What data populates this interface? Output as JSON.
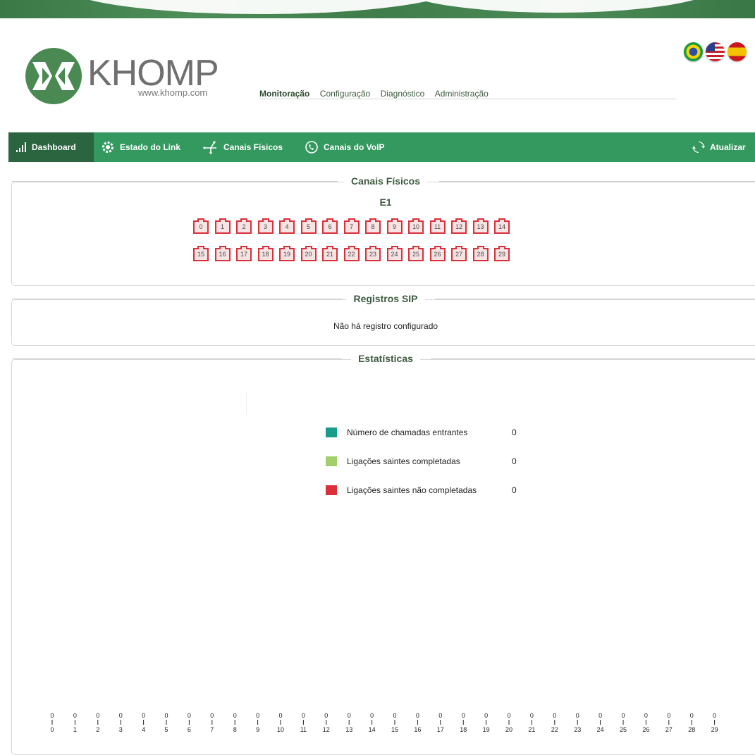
{
  "brand": {
    "name": "KHOMP",
    "url": "www.khomp.com"
  },
  "flags": [
    {
      "name": "brazil-flag-icon",
      "cls": "br"
    },
    {
      "name": "usa-flag-icon",
      "cls": "us"
    },
    {
      "name": "spain-flag-icon",
      "cls": "es"
    }
  ],
  "top_menu": [
    "Monitoração",
    "Configuração",
    "Diagnóstico",
    "Administração"
  ],
  "nav": {
    "dashboard": "Dashboard",
    "link_state": "Estado do Link",
    "physical_channels": "Canais Físicos",
    "voip_channels": "Canais do VoIP",
    "refresh": "Atualizar"
  },
  "colors": {
    "nav_bg": "#33995f",
    "nav_active": "#2b6540",
    "channel_border": "#d9303a"
  },
  "physical": {
    "title": "Canais Físicos",
    "link_label": "E1",
    "row1": [
      "0",
      "1",
      "2",
      "3",
      "4",
      "5",
      "6",
      "7",
      "8",
      "9",
      "10",
      "11",
      "12",
      "13",
      "14"
    ],
    "row2": [
      "15",
      "16",
      "17",
      "18",
      "19",
      "20",
      "21",
      "22",
      "23",
      "24",
      "25",
      "26",
      "27",
      "28",
      "29"
    ]
  },
  "sip": {
    "title": "Registros SIP",
    "message": "Não há registro configurado"
  },
  "stats": {
    "title": "Estatísticas",
    "legend": [
      {
        "name": "Número de chamadas entrantes",
        "value": "0",
        "color": "#179e8b"
      },
      {
        "name": "Ligações saintes completadas",
        "value": "0",
        "color": "#a3d06a"
      },
      {
        "name": "Ligações saintes não completadas",
        "value": "0",
        "color": "#d9303a"
      }
    ]
  },
  "chart_data": {
    "type": "bar",
    "categories": [
      "0",
      "1",
      "2",
      "3",
      "4",
      "5",
      "6",
      "7",
      "8",
      "9",
      "10",
      "11",
      "12",
      "13",
      "14",
      "15",
      "16",
      "17",
      "18",
      "19",
      "20",
      "21",
      "22",
      "23",
      "24",
      "25",
      "26",
      "27",
      "28",
      "29"
    ],
    "values": [
      0,
      0,
      0,
      0,
      0,
      0,
      0,
      0,
      0,
      0,
      0,
      0,
      0,
      0,
      0,
      0,
      0,
      0,
      0,
      0,
      0,
      0,
      0,
      0,
      0,
      0,
      0,
      0,
      0,
      0
    ]
  }
}
